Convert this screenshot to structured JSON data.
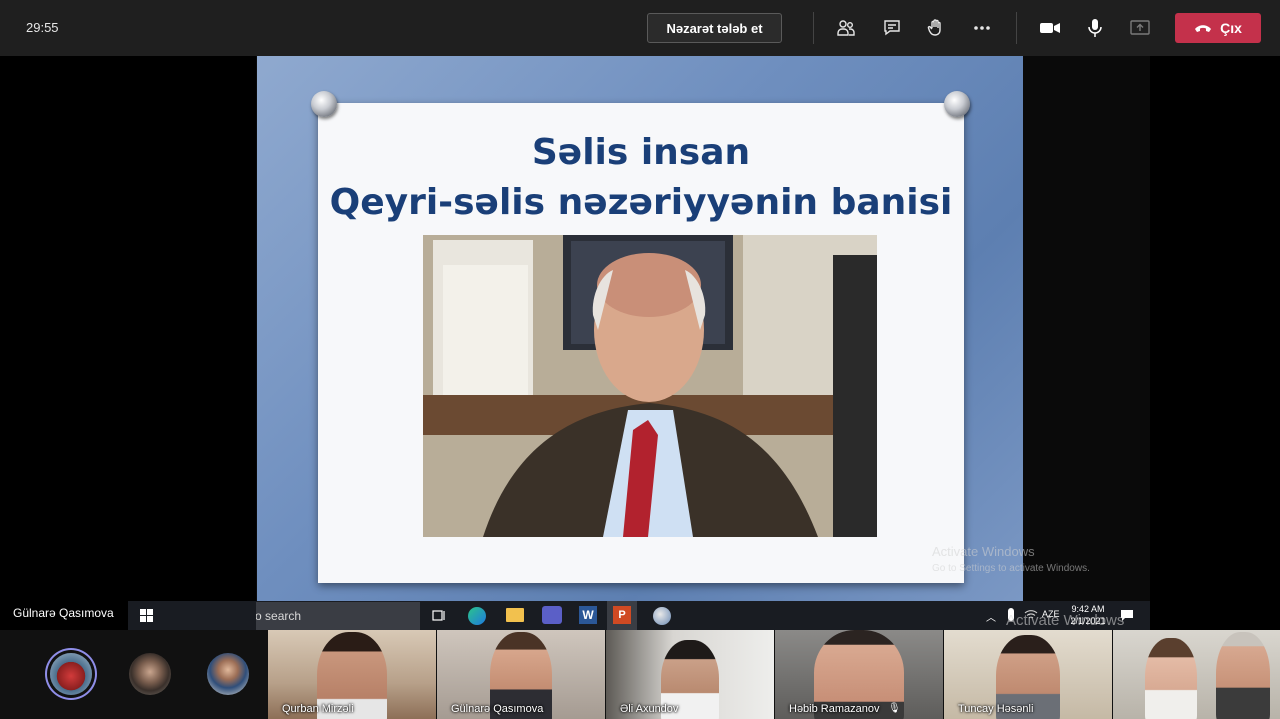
{
  "call": {
    "timer": "29:55",
    "request_control_label": "Nəzarət tələb et",
    "leave_label": "Çıx"
  },
  "slide": {
    "title_line1": "Səlis insan",
    "title_line2": "Qeyri-səlis nəzəriyyənin banisi"
  },
  "watermark": {
    "line1": "Activate Windows",
    "line2": "Go to Settings to activate Windows."
  },
  "taskbar": {
    "presenter_name": "Gülnarə Qasımova",
    "search_placeholder": "Type here to search",
    "lang": "AZE",
    "clock": "9:42 AM",
    "date": "2/1/2021"
  },
  "participants": [
    {
      "name": "Qurban Mirzəli"
    },
    {
      "name": "Gülnarə Qasımova"
    },
    {
      "name": "Əli Axundov"
    },
    {
      "name": "Həbib Ramazanov"
    },
    {
      "name": "Tuncay Həsənli"
    }
  ],
  "colors": {
    "leave": "#c4314b",
    "active_ring": "#8f8ee8",
    "slide_title": "#1a3f78"
  }
}
